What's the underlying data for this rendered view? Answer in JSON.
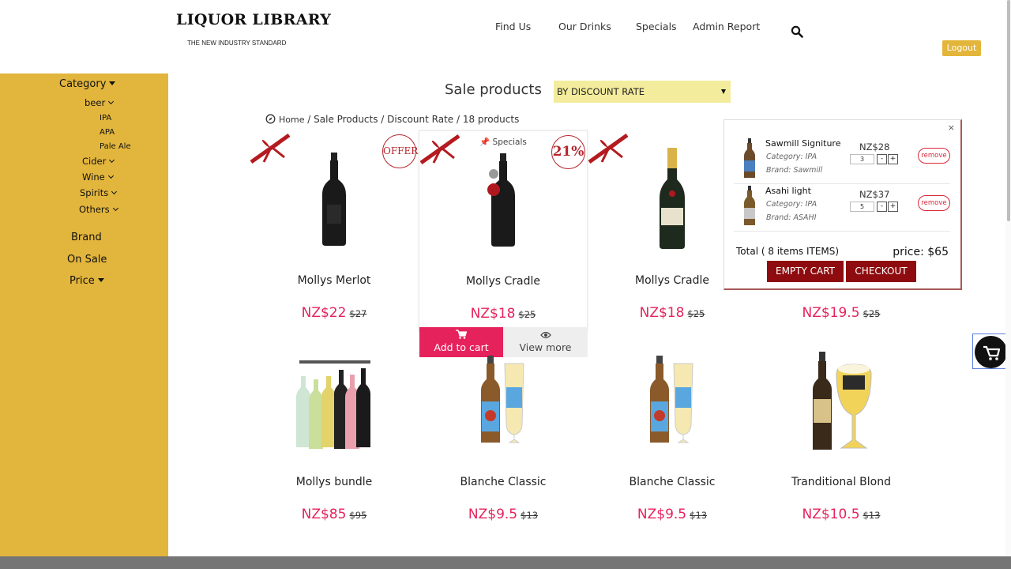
{
  "header": {
    "logo_title": "LIQUOR LIBRARY",
    "logo_subtitle": "THE NEW INDUSTRY STANDARD",
    "nav": [
      "Find Us",
      "Our Drinks",
      "Specials",
      "Admin Report"
    ],
    "logout": "Logout"
  },
  "sidebar": {
    "category": "Category",
    "beer": "beer",
    "beer_types": [
      "IPA",
      "APA",
      "Pale Ale"
    ],
    "cider": "Cider",
    "wine": "Wine",
    "spirits": "Spirits",
    "others": "Others",
    "brand": "Brand",
    "on_sale": "On Sale",
    "price": "Price"
  },
  "main": {
    "title": "Sale products",
    "sort_value": "BY DISCOUNT RATE",
    "breadcrumb": {
      "home": "Home",
      "sale": "Sale Products",
      "rate": "Discount Rate",
      "count": "18 products"
    }
  },
  "products": [
    {
      "name": "Mollys Merlot",
      "price": "NZ$22",
      "old_price": "$27",
      "badge": "OFFER"
    },
    {
      "name": "Mollys Cradle",
      "price": "NZ$18",
      "old_price": "$25",
      "badge": "21%",
      "tag": "Specials",
      "add_to_cart": "Add to cart",
      "view_more": "View more"
    },
    {
      "name": "Mollys Cradle",
      "price": "NZ$18",
      "old_price": "$25"
    },
    {
      "name": "",
      "price": "NZ$19.5",
      "old_price": "$25"
    },
    {
      "name": "Mollys bundle",
      "price": "NZ$85",
      "old_price": "$95"
    },
    {
      "name": "Blanche Classic",
      "price": "NZ$9.5",
      "old_price": "$13"
    },
    {
      "name": "Blanche Classic",
      "price": "NZ$9.5",
      "old_price": "$13"
    },
    {
      "name": "Tranditional Blond",
      "price": "NZ$10.5",
      "old_price": "$13"
    }
  ],
  "cart": {
    "close": "×",
    "items": [
      {
        "name": "Sawmill Signiture",
        "category": "Category: IPA",
        "brand": "Brand: Sawmill",
        "price": "NZ$28",
        "qty": "3",
        "remove": "remove"
      },
      {
        "name": "Asahi light",
        "category": "Category: IPA",
        "brand": "Brand: ASAHI",
        "price": "NZ$37",
        "qty": "5",
        "remove": "remove"
      }
    ],
    "minus": "-",
    "plus": "+",
    "total_label": "Total ( 8 items ITEMS)",
    "price_label": "price: $65",
    "empty_button": "EMPTY CART",
    "checkout_button": "CHECKOUT"
  },
  "colors": {
    "sidebar": "#e2b53c",
    "accent_pink": "#e6225c",
    "cart_button": "#8e0c0f",
    "sort_bg": "#f3ec9c"
  }
}
